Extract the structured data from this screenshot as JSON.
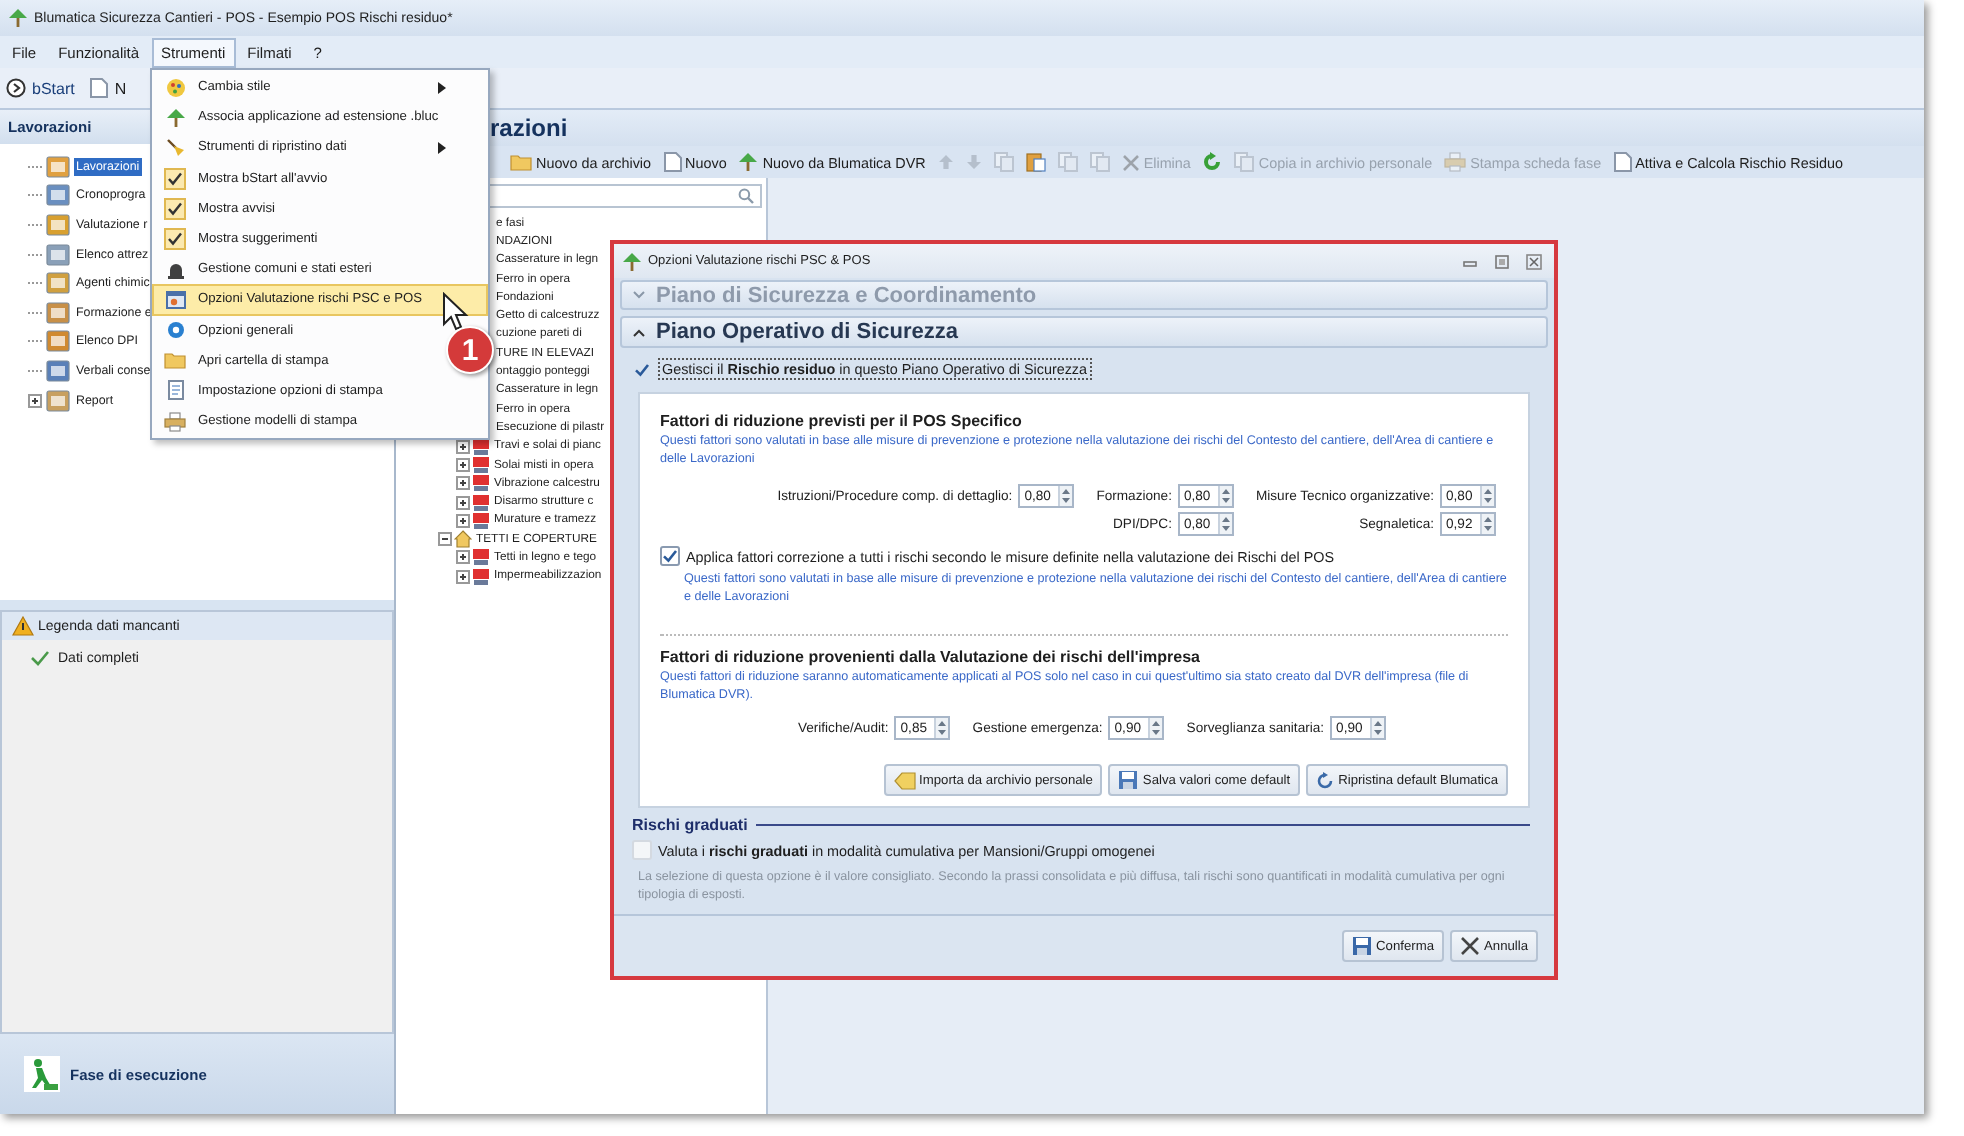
{
  "window": {
    "title": "Blumatica Sicurezza Cantieri - POS - Esempio POS Rischi residuo*"
  },
  "menu_bar": [
    {
      "label": "File",
      "selected": false
    },
    {
      "label": "Funzionalità",
      "selected": false
    },
    {
      "label": "Strumenti",
      "selected": true
    },
    {
      "label": "Filmati",
      "selected": false
    },
    {
      "label": "?",
      "selected": false
    }
  ],
  "toolbar": [
    "bStart",
    "N"
  ],
  "sidebar": {
    "title": "Lavorazioni",
    "items": [
      {
        "label": "Lavorazioni",
        "selected": true,
        "kind": "item"
      },
      {
        "label": "Cronoprogra",
        "selected": false,
        "kind": "item"
      },
      {
        "label": "Valutazione r",
        "selected": false,
        "kind": "item"
      },
      {
        "label": "Elenco attrez",
        "selected": false,
        "kind": "item"
      },
      {
        "label": "Agenti chimic",
        "selected": false,
        "kind": "item"
      },
      {
        "label": "Formazione e",
        "selected": false,
        "kind": "item"
      },
      {
        "label": "Elenco DPI",
        "selected": false,
        "kind": "item"
      },
      {
        "label": "Verbali conse",
        "selected": false,
        "kind": "item"
      },
      {
        "label": "Report",
        "selected": false,
        "kind": "folder"
      }
    ]
  },
  "legend": {
    "title": "Legenda dati mancanti",
    "items": [
      "Dati completi"
    ]
  },
  "footer_nav": {
    "label": "Fase di esecuzione"
  },
  "main": {
    "title": "razioni",
    "toolbar": [
      {
        "label": "Nuovo da archivio",
        "disabled": false
      },
      {
        "label": "Nuovo",
        "disabled": false
      },
      {
        "label": "Nuovo da Blumatica DVR",
        "disabled": false
      },
      {
        "disabled": true
      },
      {
        "disabled": true
      },
      {
        "disabled": true
      },
      {
        "disabled": false
      },
      {
        "disabled": true
      },
      {
        "disabled": true
      },
      {
        "label": "Elimina",
        "disabled": true
      },
      {
        "disabled": false
      },
      {
        "label": "Copia in archivio personale",
        "disabled": true
      },
      {
        "label": "Stampa scheda fase",
        "disabled": true
      },
      {
        "label": "Attiva e Calcola Rischio Residuo",
        "disabled": false
      }
    ],
    "tree": [
      {
        "label": "e fasi",
        "children": [
          {
            "label": "NDAZIONI",
            "children": [
              {
                "label": "Casserature in legn"
              },
              {
                "label": "Ferro in opera"
              },
              {
                "label": "Fondazioni"
              },
              {
                "label": "Getto di calcestruzz"
              },
              {
                "label": "cuzione pareti di"
              }
            ]
          },
          {
            "label": "TURE IN ELEVAZI",
            "children": [
              {
                "label": "ontaggio ponteggi"
              },
              {
                "label": "Casserature in legn"
              },
              {
                "label": "Ferro in opera"
              },
              {
                "label": "Esecuzione di pilastr"
              },
              {
                "label": "Travi e solai di pianc",
                "expanded": false
              },
              {
                "label": "Solai misti in opera",
                "expanded": false
              },
              {
                "label": "Vibrazione calcestru",
                "expanded": false
              },
              {
                "label": "Disarmo strutture c",
                "expanded": false
              },
              {
                "label": "Murature e tramezz",
                "expanded": false
              }
            ]
          },
          {
            "label": "TETTI E COPERTURE",
            "expanded": true,
            "children": [
              {
                "label": "Tetti in legno e tego",
                "expanded": false
              },
              {
                "label": "Impermeabilizzazion",
                "expanded": false
              }
            ]
          }
        ]
      }
    ]
  },
  "menu": {
    "items": [
      {
        "label": "Cambia stile",
        "checked": false,
        "submenu": true,
        "selected": false
      },
      {
        "label": "Associa applicazione ad estensione .bluc",
        "checked": false,
        "submenu": false,
        "selected": false
      },
      {
        "label": "Strumenti di ripristino dati",
        "checked": false,
        "submenu": true,
        "selected": false
      },
      {
        "label": "Mostra bStart all'avvio",
        "checked": true,
        "submenu": false,
        "selected": false
      },
      {
        "label": "Mostra avvisi",
        "checked": true,
        "submenu": false,
        "selected": false
      },
      {
        "label": "Mostra suggerimenti",
        "checked": true,
        "submenu": false,
        "selected": false
      },
      {
        "label": "Gestione comuni e stati esteri",
        "checked": false,
        "submenu": false,
        "selected": false
      },
      {
        "label": "Opzioni Valutazione rischi PSC e POS",
        "checked": false,
        "submenu": false,
        "selected": true
      },
      {
        "label": "Opzioni generali",
        "checked": false,
        "submenu": false,
        "selected": false
      },
      {
        "label": "Apri cartella di stampa",
        "checked": false,
        "submenu": false,
        "selected": false
      },
      {
        "label": "Impostazione opzioni di stampa",
        "checked": false,
        "submenu": false,
        "selected": false
      },
      {
        "label": "Gestione modelli di stampa",
        "checked": false,
        "submenu": false,
        "selected": false
      }
    ]
  },
  "callout": "1",
  "dialog": {
    "title": "Opzioni Valutazione rischi PSC & POS",
    "sections": [
      {
        "title": "Piano di Sicurezza e Coordinamento",
        "expanded": false
      },
      {
        "title": "Piano Operativo di Sicurezza",
        "expanded": true
      }
    ],
    "manage_residual": {
      "label": "Gestisci il **Rischio residuo** in questo Piano Operativo di Sicurezza",
      "checked": true
    },
    "pos_factors": {
      "title": "Fattori di riduzione previsti per il POS Specifico",
      "description": "Questi fattori sono valutati in base alle misure di prevenzione e protezione nella valutazione dei rischi del Contesto del cantiere, dell'Area di cantiere e delle Lavorazioni",
      "fields": [
        {
          "label": "Istruzioni/Procedure comp. di dettaglio:",
          "value": "0,80"
        },
        {
          "label": "Formazione:",
          "value": "0,80"
        },
        {
          "label": "Misure Tecnico organizzative:",
          "value": "0,80"
        },
        {
          "label": "DPI/DPC:",
          "value": "0,80"
        },
        {
          "label": "Segnaletica:",
          "value": "0,92"
        }
      ]
    },
    "apply_all": {
      "label": "Applica fattori correzione a tutti i rischi secondo le misure definite nella valutazione dei Rischi del POS",
      "checked": true,
      "description": "Questi fattori sono valutati in base alle misure di prevenzione e protezione nella valutazione dei rischi del Contesto del cantiere, dell'Area di cantiere e delle Lavorazioni"
    },
    "company_factors": {
      "title": "Fattori di riduzione provenienti dalla Valutazione dei rischi dell'impresa",
      "description": "Questi fattori di riduzione saranno automaticamente applicati al POS solo nel caso in cui quest'ultimo sia stato creato dal DVR dell'impresa (file di Blumatica DVR).",
      "fields": [
        {
          "label": "Verifiche/Audit:",
          "value": "0,85"
        },
        {
          "label": "Gestione emergenza:",
          "value": "0,90"
        },
        {
          "label": "Sorveglianza sanitaria:",
          "value": "0,90"
        }
      ]
    },
    "buttons": [
      "Importa da archivio personale",
      "Salva valori come default",
      "Ripristina default Blumatica"
    ],
    "graduated": {
      "title": "Rischi graduati",
      "label": "Valuta i **rischi graduati** in modalità cumulativa per Mansioni/Gruppi omogenei",
      "checked": false,
      "description": "La selezione di questa opzione è il valore consigliato. Secondo la prassi consolidata e più diffusa, tali rischi sono quantificati in modalità cumulativa per ogni tipologia di esposti."
    },
    "footer_buttons": [
      "Conferma",
      "Annulla"
    ]
  }
}
